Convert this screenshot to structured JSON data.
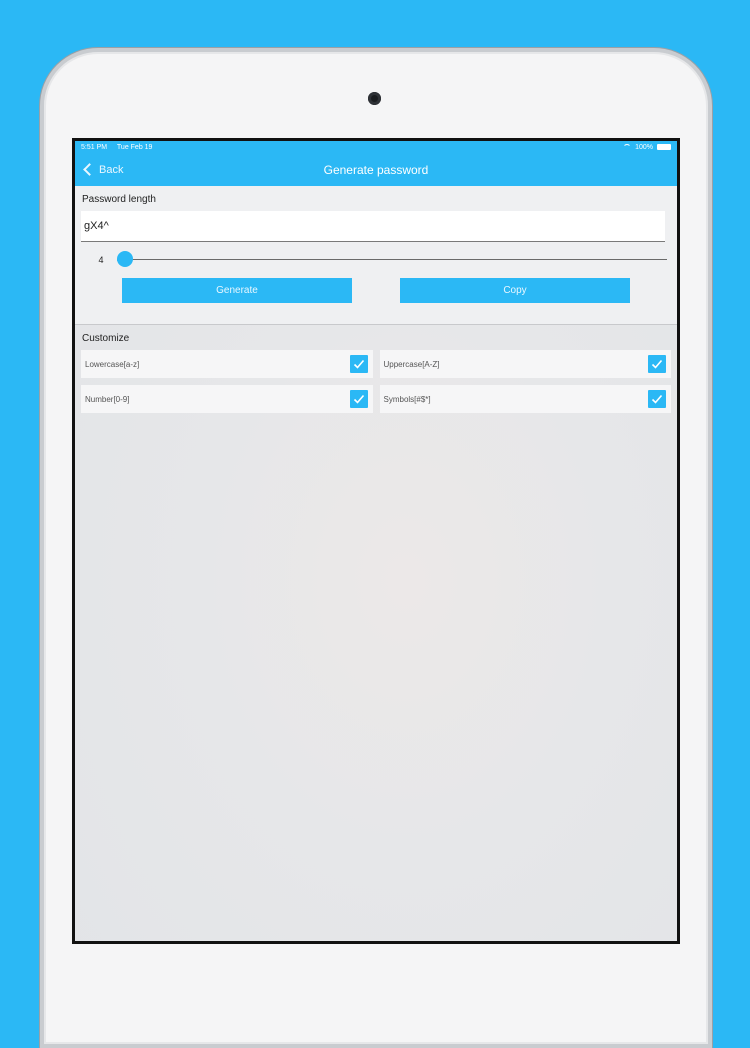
{
  "status_bar": {
    "time": "5:51 PM",
    "date": "Tue Feb 19",
    "battery": "100%"
  },
  "nav": {
    "back_label": "Back",
    "title": "Generate password"
  },
  "password": {
    "section_title": "Password length",
    "value": "gX4^",
    "length_label": "4",
    "slider_fraction": 0.0
  },
  "buttons": {
    "generate": "Generate",
    "copy": "Copy"
  },
  "customize": {
    "section_title": "Customize",
    "options": [
      {
        "label": "Lowercase[a-z]",
        "checked": true
      },
      {
        "label": "Uppercase[A-Z]",
        "checked": true
      },
      {
        "label": "Number[0-9]",
        "checked": true
      },
      {
        "label": "Symbols[#$*]",
        "checked": true
      }
    ]
  },
  "colors": {
    "accent": "#2bb8f5"
  }
}
